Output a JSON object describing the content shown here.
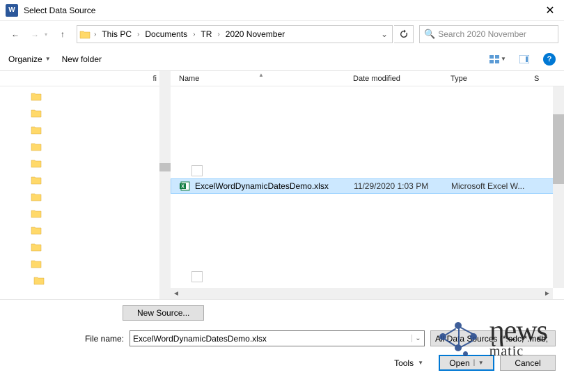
{
  "window": {
    "title": "Select Data Source",
    "app_glyph": "W"
  },
  "nav": {
    "breadcrumb": [
      "This PC",
      "Documents",
      "TR",
      "2020 November"
    ]
  },
  "search": {
    "placeholder": "Search 2020 November"
  },
  "toolbar": {
    "organize": "Organize",
    "new_folder": "New folder"
  },
  "tree_header": "fi",
  "headers": {
    "name": "Name",
    "date": "Date modified",
    "type": "Type",
    "size": "S"
  },
  "files": [
    {
      "name": "ExcelWordDynamicDatesDemo.xlsx",
      "date": "11/29/2020 1:03 PM",
      "type": "Microsoft Excel W...",
      "selected": true
    }
  ],
  "bottom": {
    "new_source": "New Source...",
    "filename_label": "File name:",
    "filename_value": "ExcelWordDynamicDatesDemo.xlsx",
    "filetype": "All Data Sources (*.odc;*.mdb;",
    "tools": "Tools",
    "open": "Open",
    "cancel": "Cancel"
  }
}
